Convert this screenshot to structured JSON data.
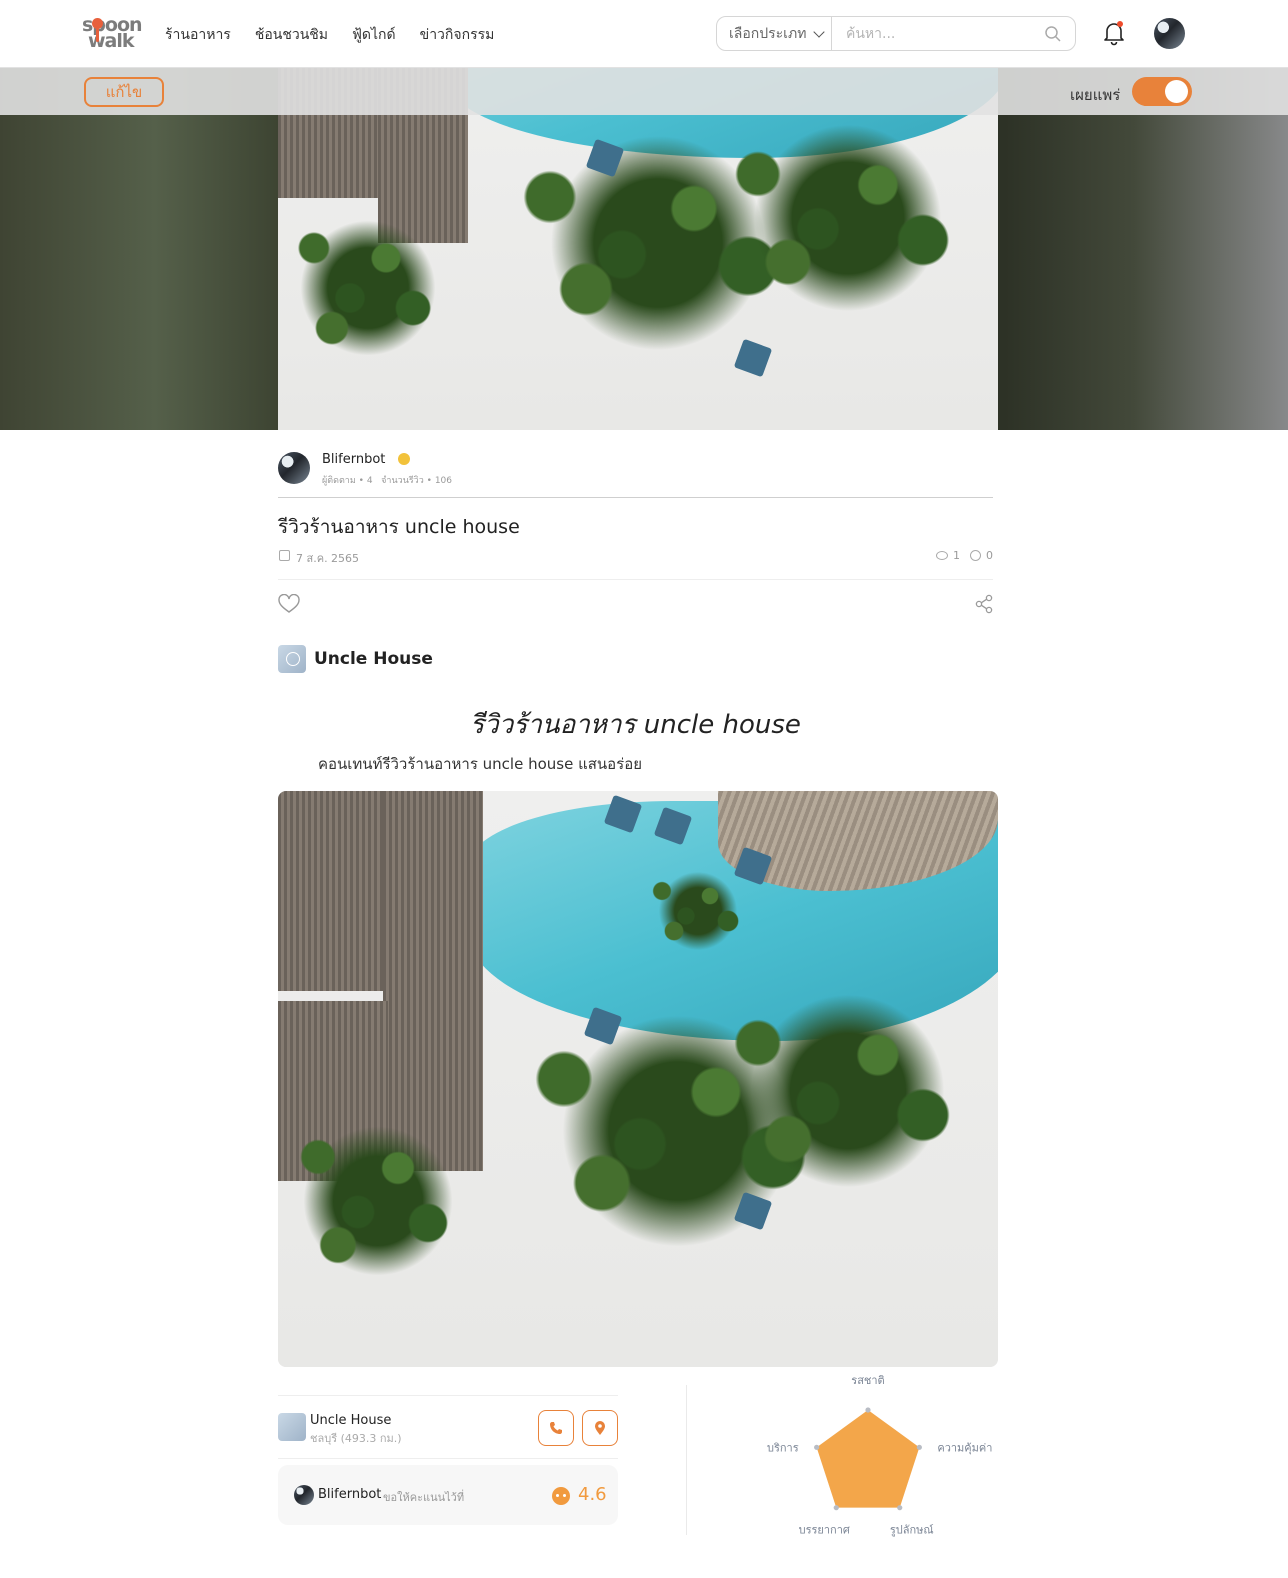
{
  "header": {
    "logo_top": "spoon",
    "logo_bottom": "walk",
    "nav": [
      "ร้านอาหาร",
      "ช้อนชวนชิม",
      "ฟู้ดไกด์",
      "ข่าวกิจกรรม"
    ],
    "search_type": "เลือกประเภท",
    "search_placeholder": "ค้นหา..."
  },
  "admin": {
    "edit_label": "แก้ไข",
    "publish_label": "เผยแพร่",
    "publish_on": true
  },
  "author": {
    "name": "Blifernbot",
    "followers_label": "ผู้ติดตาม",
    "followers": "4",
    "reviews_label": "จำนวนรีวิว",
    "reviews": "106"
  },
  "post": {
    "title": "รีวิวร้านอาหาร uncle house",
    "date": "7 ส.ค. 2565",
    "views": "1",
    "comments": "0"
  },
  "restaurant": {
    "name": "Uncle House",
    "location": "ชลบุรี (493.3 กม.)"
  },
  "article": {
    "heading": "รีวิวร้านอาหาร uncle house",
    "paragraph": "คอนเทนท์รีวิวร้านอาหาร uncle house แสนอร่อย"
  },
  "rating": {
    "reviewer": "Blifernbot",
    "text": "ขอให้คะแนนไว้ที่",
    "score": "4.6",
    "accent_color": "#f19a3e"
  },
  "radar": {
    "labels": [
      "รสชาติ",
      "ความคุ้มค่า",
      "รูปลักษณ์",
      "บรรยากาศ",
      "บริการ"
    ],
    "values": [
      5,
      5,
      5,
      5,
      5
    ],
    "max": 5,
    "fill_color": "#f3a64a"
  },
  "colors": {
    "accent": "#e8823a"
  }
}
